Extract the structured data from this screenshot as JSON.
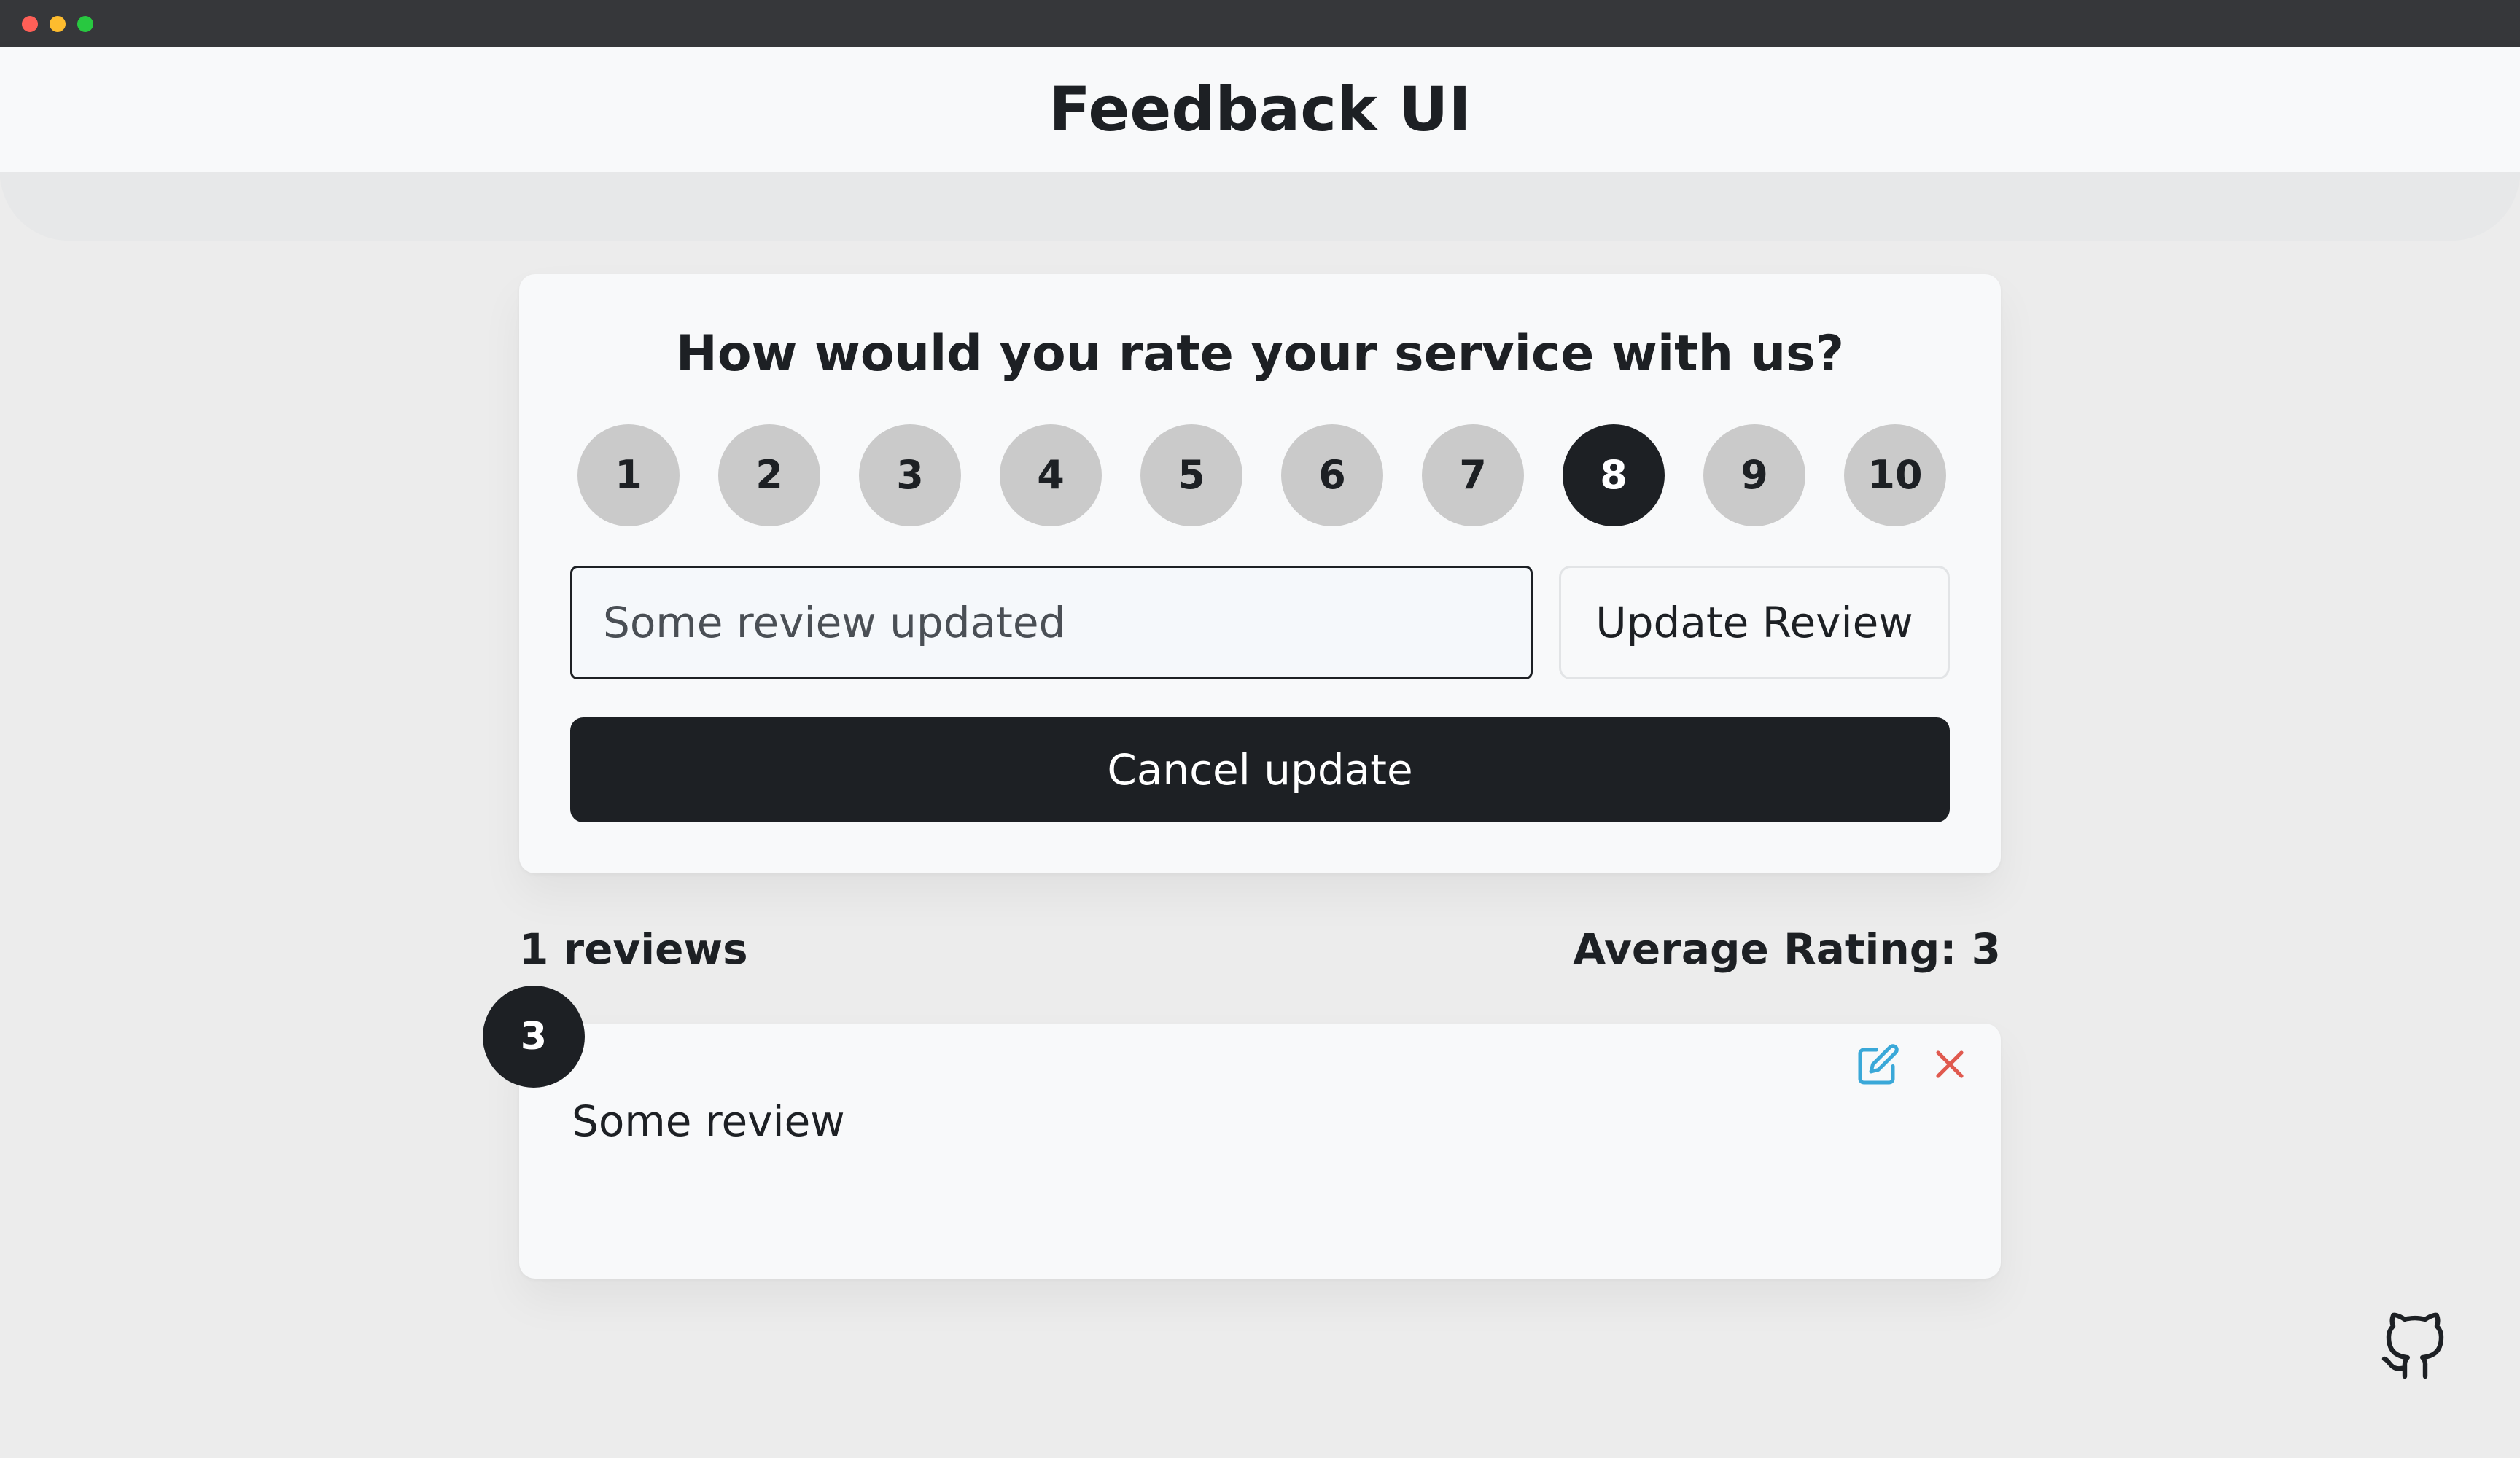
{
  "window": {
    "traffic_lights": [
      "#ff5f57",
      "#febc2e",
      "#28c840"
    ]
  },
  "header": {
    "title": "Feedback UI"
  },
  "feedback_form": {
    "question": "How would you rate your service with us?",
    "ratings": [
      "1",
      "2",
      "3",
      "4",
      "5",
      "6",
      "7",
      "8",
      "9",
      "10"
    ],
    "selected_rating": "8",
    "review_input_value": "Some review updated",
    "update_button_label": "Update Review",
    "cancel_button_label": "Cancel update"
  },
  "stats": {
    "review_count": "1 reviews",
    "average_rating": "Average Rating: 3"
  },
  "reviews": [
    {
      "rating": "3",
      "text": "Some review"
    }
  ],
  "icons": {
    "edit": "edit-icon",
    "delete": "close-icon",
    "github": "github-icon"
  },
  "colors": {
    "dark": "#1d2024",
    "rating_inactive": "#cacaca",
    "edit_icon": "#3aa8d8",
    "delete_icon": "#e05a4f",
    "background": "#ececec",
    "card": "#f8f9fa"
  }
}
